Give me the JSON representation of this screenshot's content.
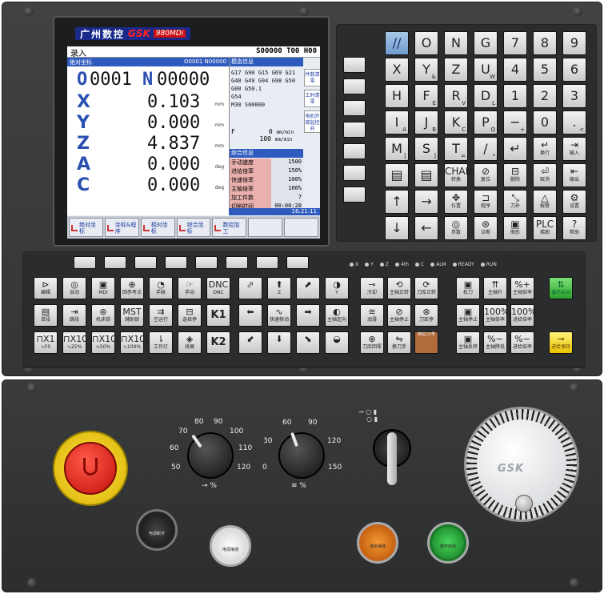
{
  "brand": {
    "cn": "广州数控",
    "gsk": "GSK",
    "model": "980MDi"
  },
  "screen": {
    "mode": "录入",
    "status": "S00000 T00 H00",
    "coord_title": "绝对坐标",
    "coord_prog": "O0001 N00000",
    "program": {
      "o_letter": "O",
      "o_num": "0001",
      "n_letter": "N",
      "n_num": "00000"
    },
    "axes": [
      {
        "letter": "X",
        "value": "0.103",
        "unit": "mm"
      },
      {
        "letter": "Y",
        "value": "0.000",
        "unit": "mm"
      },
      {
        "letter": "Z",
        "value": "4.837",
        "unit": "mm"
      },
      {
        "letter": "A",
        "value": "0.000",
        "unit": "deg"
      },
      {
        "letter": "C",
        "value": "0.000",
        "unit": "deg"
      }
    ],
    "state_title": "模态信息",
    "gcodes": [
      "G17 G90 G15 G69 G21",
      "G40 G49 G94 G98 G50",
      "G00 G50.1",
      "G54",
      "M30 S00000"
    ],
    "side_tabs": [
      "件数清零",
      "工时清零",
      "电机外部监控开"
    ],
    "feed": {
      "f_label": "F",
      "f_value": "0",
      "f_unit": "mm/min",
      "f2_value": "100",
      "f2_unit": "mm/min"
    },
    "info_title": "综合信息",
    "info": [
      {
        "label": "手动速度",
        "value": "1500"
      },
      {
        "label": "进给倍率",
        "value": "150%"
      },
      {
        "label": "快速倍率",
        "value": "100%"
      },
      {
        "label": "主轴倍率",
        "value": "100%"
      },
      {
        "label": "加工件数",
        "value": "7"
      },
      {
        "label": "切削时间",
        "value": "00:00:28"
      }
    ],
    "clock": "16:21:11",
    "softkeys": [
      "绝对坐标",
      "坐标&程序",
      "相对坐标",
      "综合坐标",
      "数控加工"
    ]
  },
  "keypad": {
    "rows": [
      [
        {
          "g": "//",
          "s": ""
        },
        {
          "g": "O",
          "s": ""
        },
        {
          "g": "N",
          "s": ""
        },
        {
          "g": "G",
          "s": ""
        },
        {
          "g": "7",
          "s": ""
        },
        {
          "g": "8",
          "s": ""
        },
        {
          "g": "9",
          "s": ""
        }
      ],
      [
        {
          "g": "X",
          "s": ""
        },
        {
          "g": "Y",
          "s": "&"
        },
        {
          "g": "Z",
          "s": ""
        },
        {
          "g": "U",
          "s": "W"
        },
        {
          "g": "4",
          "s": ""
        },
        {
          "g": "5",
          "s": ""
        },
        {
          "g": "6",
          "s": ""
        }
      ],
      [
        {
          "g": "H",
          "s": ""
        },
        {
          "g": "F",
          "s": "E"
        },
        {
          "g": "R",
          "s": "V"
        },
        {
          "g": "D",
          "s": "L"
        },
        {
          "g": "1",
          "s": ""
        },
        {
          "g": "2",
          "s": ""
        },
        {
          "g": "3",
          "s": ""
        }
      ],
      [
        {
          "g": "I",
          "s": "A"
        },
        {
          "g": "J",
          "s": "B"
        },
        {
          "g": "K",
          "s": "C"
        },
        {
          "g": "P",
          "s": "Q"
        },
        {
          "g": "−",
          "s": "+"
        },
        {
          "g": "0",
          "s": ""
        },
        {
          "g": ".",
          "s": "<"
        }
      ],
      [
        {
          "g": "M",
          "s": "["
        },
        {
          "g": "S",
          "s": "]"
        },
        {
          "g": "T",
          "s": "="
        },
        {
          "g": "/",
          "s": "*"
        },
        {
          "g": "↵",
          "s": ""
        },
        {
          "g": "↵",
          "s": "换行"
        },
        {
          "g": "⇥",
          "s": "输入"
        }
      ],
      [
        {
          "g": "▤",
          "s": ""
        },
        {
          "g": "▤",
          "s": ""
        },
        {
          "g": "CHANGE",
          "s": "转换"
        },
        {
          "g": "⊘",
          "s": "复位"
        },
        {
          "g": "⊟",
          "s": "删除"
        },
        {
          "g": "⏎",
          "s": "取消"
        },
        {
          "g": "⇤",
          "s": "输出"
        }
      ],
      [
        {
          "g": "↑",
          "s": ""
        },
        {
          "g": "→",
          "s": ""
        },
        {
          "g": "✥",
          "s": "位置"
        },
        {
          "g": "⊐",
          "s": "程序"
        },
        {
          "g": "⤡",
          "s": "刀补"
        },
        {
          "g": "△",
          "s": "报警"
        },
        {
          "g": "⚙",
          "s": "设置"
        }
      ],
      [
        {
          "g": "↓",
          "s": ""
        },
        {
          "g": "←",
          "s": ""
        },
        {
          "g": "◎",
          "s": "参数"
        },
        {
          "g": "⊛",
          "s": "诊断"
        },
        {
          "g": "▣",
          "s": "图形"
        },
        {
          "g": "PLC",
          "s": "梯图"
        },
        {
          "g": "?",
          "s": "帮助"
        }
      ]
    ]
  },
  "leds": [
    "X",
    "Y",
    "Z",
    "4th",
    "C",
    "ALM",
    "READY",
    "RUN"
  ],
  "op_keys_left": [
    [
      {
        "g": "⊳",
        "s": "编辑"
      },
      {
        "g": "◎",
        "s": "自动"
      },
      {
        "g": "▣",
        "s": "MDI"
      },
      {
        "g": "⊕",
        "s": "回参考点"
      },
      {
        "g": "◔",
        "s": "手脉"
      },
      {
        "g": "☞",
        "s": "手动"
      },
      {
        "g": "DNC",
        "s": "DNC"
      }
    ],
    [
      {
        "g": "▤",
        "s": "单段"
      },
      {
        "g": "⇥",
        "s": "跳段"
      },
      {
        "g": "⊛",
        "s": "机床锁"
      },
      {
        "g": "MST",
        "s": "辅助锁"
      },
      {
        "g": "⇉",
        "s": "空运行"
      },
      {
        "g": "⊟",
        "s": "选择停"
      },
      {
        "g": "K1",
        "s": ""
      }
    ],
    [
      {
        "g": "⊓X1",
        "s": "∿F0"
      },
      {
        "g": "⊓X10",
        "s": "∿25%"
      },
      {
        "g": "⊓X100",
        "s": "∿50%"
      },
      {
        "g": "⊓X1000",
        "s": "∿100%"
      },
      {
        "g": "⇂",
        "s": "工作灯"
      },
      {
        "g": "◈",
        "s": "排屑"
      },
      {
        "g": "K2",
        "s": ""
      }
    ]
  ],
  "op_keys_mid": [
    [
      {
        "g": "⬀",
        "s": ""
      },
      {
        "g": "⬆",
        "s": "Z"
      },
      {
        "g": "⬈",
        "s": ""
      },
      {
        "g": "◑",
        "s": "Y"
      }
    ],
    [
      {
        "g": "⬅",
        "s": ""
      },
      {
        "g": "∿",
        "s": "快速移动"
      },
      {
        "g": "➡",
        "s": ""
      },
      {
        "g": "◐",
        "s": "主轴定向"
      }
    ],
    [
      {
        "g": "⬋",
        "s": ""
      },
      {
        "g": "⬇",
        "s": ""
      },
      {
        "g": "⬊",
        "s": ""
      },
      {
        "g": "◒",
        "s": ""
      }
    ]
  ],
  "op_keys_right": [
    [
      {
        "g": "⊸",
        "s": "冷却"
      },
      {
        "g": "⟲",
        "s": "主轴正转"
      },
      {
        "g": "⟳",
        "s": "刀库正转"
      },
      {
        "g": "▣",
        "s": "松刀"
      },
      {
        "g": "⇈",
        "s": "主轴升"
      },
      {
        "g": "%+",
        "s": "主轴倍率"
      }
    ],
    [
      {
        "g": "≋",
        "s": "润滑"
      },
      {
        "g": "⊘",
        "s": "主轴停止"
      },
      {
        "g": "⊗",
        "s": "刀库停"
      },
      {
        "g": "▣",
        "s": "主轴停止"
      },
      {
        "g": "100%",
        "s": "主轴倍率"
      },
      {
        "g": "100%",
        "s": "进给倍率"
      }
    ],
    [
      {
        "g": "⊕",
        "s": "刀库回零"
      },
      {
        "g": "⇋",
        "s": "换刀手"
      },
      {
        "g": "",
        "s": ""
      },
      {
        "g": "▣",
        "s": "主轴反转"
      },
      {
        "g": "%−",
        "s": "主轴降低"
      },
      {
        "g": "%−",
        "s": "进给倍率"
      }
    ]
  ],
  "slot_label": "档位/刀号",
  "cycle_start": "循环启动",
  "feed_hold": "进给保持",
  "dial_left": {
    "ticks": [
      "50",
      "60",
      "70",
      "80",
      "90",
      "100",
      "110",
      "120"
    ],
    "label": "%"
  },
  "dial_right": {
    "ticks": [
      "0",
      "30",
      "60",
      "90",
      "120",
      "150"
    ],
    "label": "%"
  },
  "bottom_buttons": {
    "power_off": "电源断开",
    "power_on": "电源接通",
    "feed_hold": "进给保持",
    "cycle_start": "循环启动"
  },
  "handwheel_logo": "GSK",
  "colors": {
    "accent_blue": "#2f5bbf",
    "info_pink": "#e9b0ae",
    "estop_red": "#d8140e",
    "estop_yellow": "#f2cd16",
    "green": "#2aa12a",
    "yellow": "#e7c400"
  }
}
